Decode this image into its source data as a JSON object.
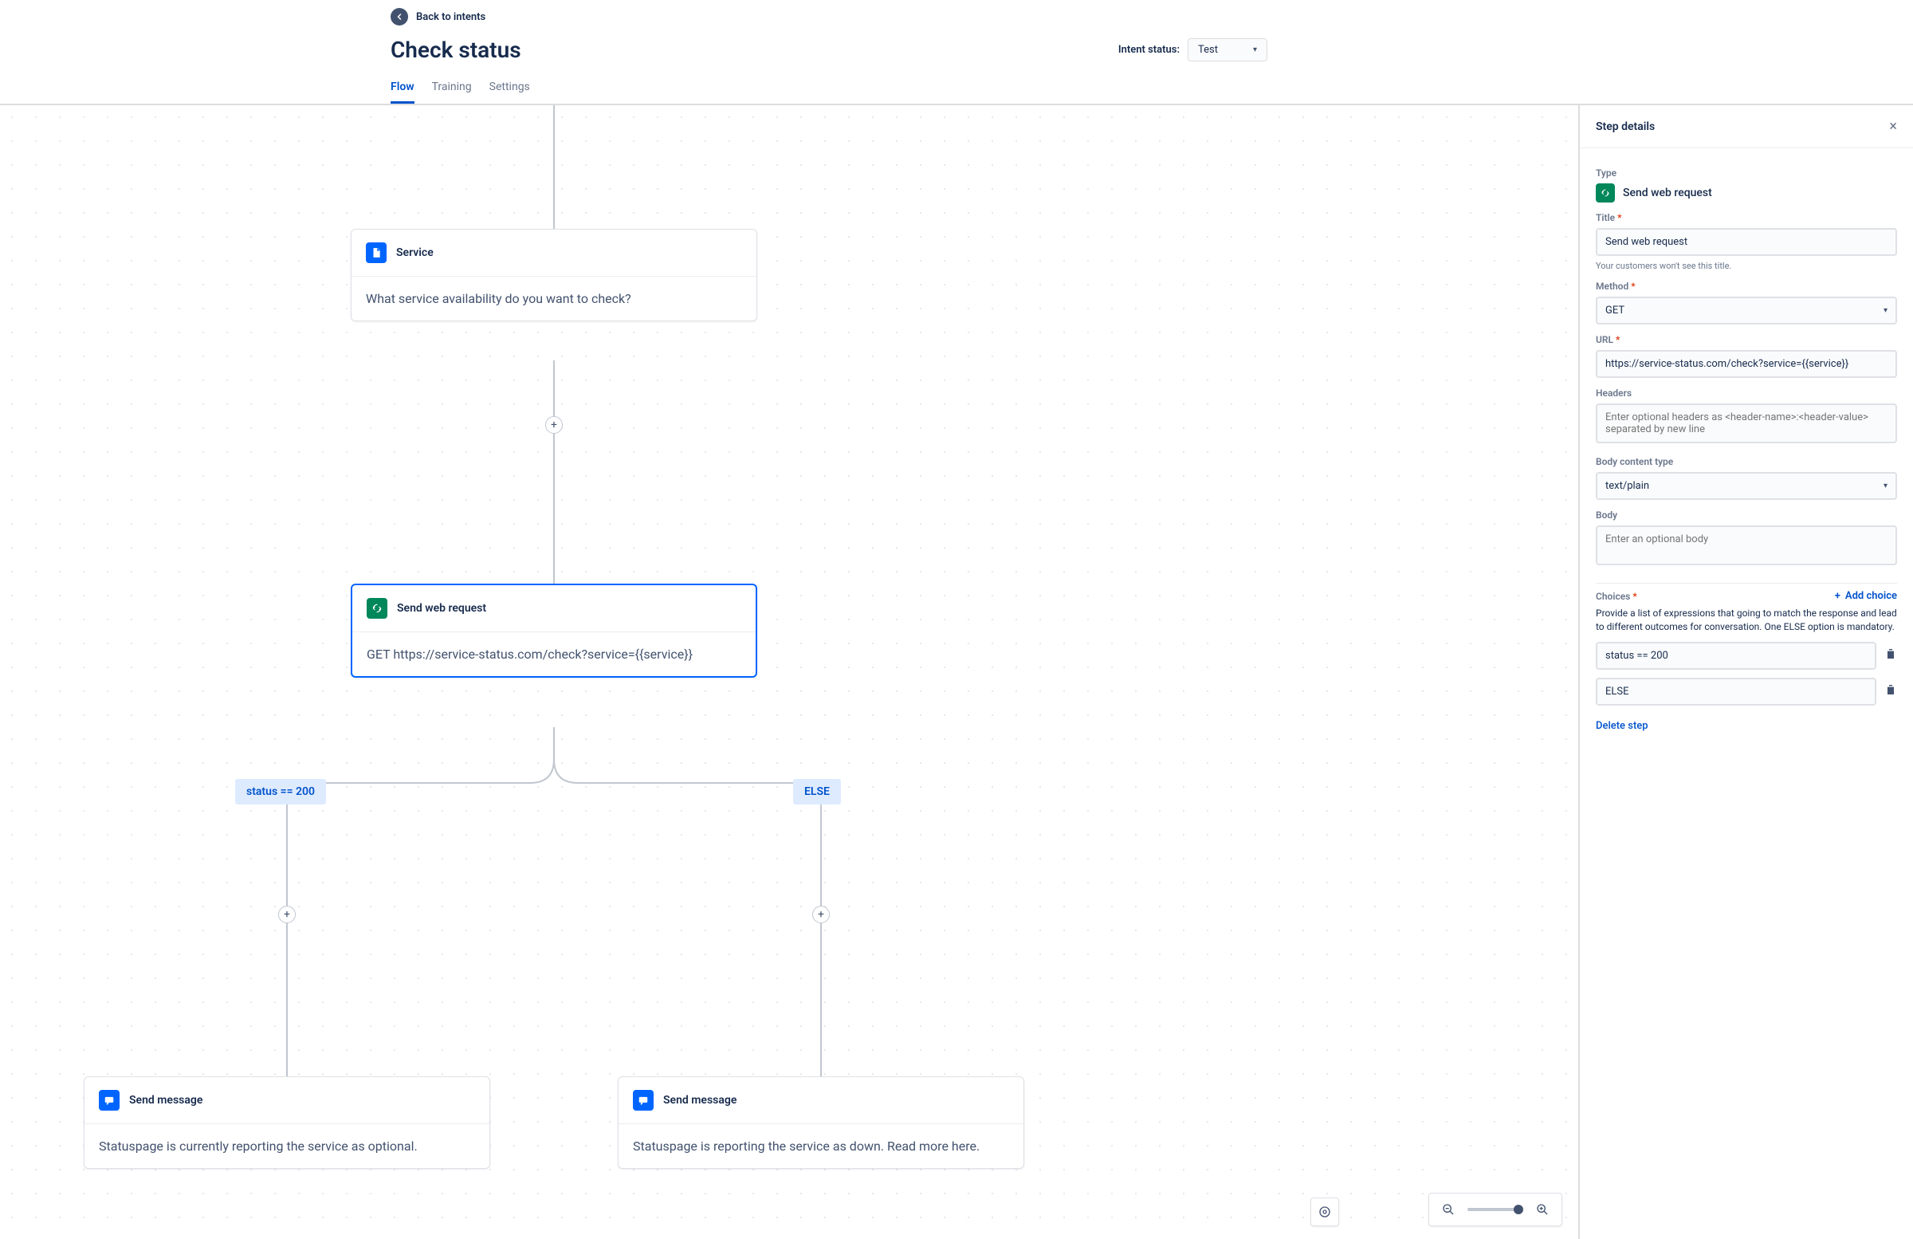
{
  "header": {
    "back_label": "Back to intents",
    "title": "Check status",
    "status_label": "Intent status:",
    "status_value": "Test",
    "tabs": [
      {
        "label": "Flow",
        "active": true
      },
      {
        "label": "Training",
        "active": false
      },
      {
        "label": "Settings",
        "active": false
      }
    ]
  },
  "canvas": {
    "nodes": {
      "service": {
        "title": "Service",
        "body": "What service availability do you want to check?"
      },
      "web_request": {
        "title": "Send web request",
        "body": "GET https://service-status.com/check?service={{service}}"
      },
      "send_left": {
        "title": "Send message",
        "body": "Statuspage is currently reporting the service as optional."
      },
      "send_right": {
        "title": "Send message",
        "body": "Statuspage is reporting the service as down. Read more here."
      }
    },
    "branches": {
      "left": "status == 200",
      "right": "ELSE"
    }
  },
  "panel": {
    "title": "Step details",
    "type_label": "Type",
    "type_value": "Send web request",
    "title_label": "Title",
    "title_value": "Send web request",
    "title_help": "Your customers won't see this title.",
    "method_label": "Method",
    "method_value": "GET",
    "url_label": "URL",
    "url_value": "https://service-status.com/check?service={{service}}",
    "headers_label": "Headers",
    "headers_placeholder": "Enter optional headers as <header-name>:<header-value> separated by new line",
    "body_type_label": "Body content type",
    "body_type_value": "text/plain",
    "body_label": "Body",
    "body_placeholder": "Enter an optional body",
    "choices_label": "Choices",
    "add_choice_label": "Add choice",
    "choices_desc": "Provide a list of expressions that going to match the response and lead to different outcomes for conversation. One ELSE option is mandatory.",
    "choices": [
      {
        "value": "status == 200"
      },
      {
        "value": "ELSE"
      }
    ],
    "delete_label": "Delete step"
  }
}
